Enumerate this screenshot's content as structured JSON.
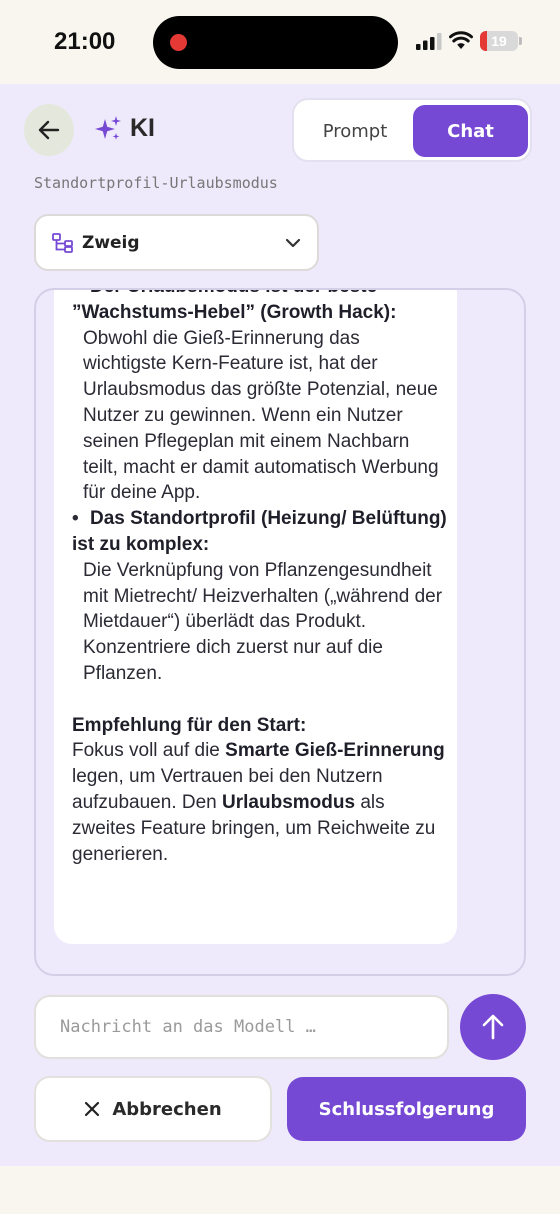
{
  "status_bar": {
    "time": "21:00",
    "battery_level": "19",
    "icons": [
      "cellular-signal-icon",
      "wifi-icon",
      "battery-icon"
    ],
    "recording_indicator_color": "#e53935"
  },
  "header": {
    "back_icon": "arrow-left-icon",
    "title_icon": "sparkles-icon",
    "title": "KI",
    "tabs": [
      {
        "label": "Prompt",
        "active": false
      },
      {
        "label": "Chat",
        "active": true
      }
    ]
  },
  "context_label": "Standortprofil-Urlaubsmodus",
  "model_select": {
    "icon": "branch-icon",
    "selected": "Zweig",
    "chevron_icon": "chevron-down-icon"
  },
  "response": {
    "partial_top_line": "Der Urlaubsmodus ist der beste",
    "sections": [
      {
        "heading": "”Wachstums-Hebel” (Growth Hack):",
        "body": "Obwohl die Gieß-Erinnerung das wichtigste Kern-Feature ist, hat der Urlaubsmodus das größte Potenzial, neue Nutzer zu gewinnen. Wenn ein Nutzer seinen Pflegeplan mit einem Nachbarn teilt, macht er damit automatisch Werbung für deine App."
      },
      {
        "heading": "Das Standortprofil (Heizung/ Belüftung) ist zu komplex:",
        "body": "Die Verknüpfung von Pflanzengesundheit mit Mietrecht/ Heizverhalten („während der Mietdauer“) überlädt das Produkt. Konzentriere dich zuerst nur auf die Pflanzen."
      }
    ],
    "recommendation": {
      "heading": "Empfehlung für den Start:",
      "text_1": "Fokus voll auf die ",
      "bold_1": "Smarte Gieß-Erinnerung",
      "text_2": " legen, um Vertrauen bei den Nutzern aufzubauen. Den ",
      "bold_2": "Urlaubsmodus",
      "text_3": " als zweites Feature bringen, um Reichweite zu generieren."
    }
  },
  "composer": {
    "placeholder": "Nachricht an das Modell …",
    "value": "",
    "send_icon": "arrow-up-icon"
  },
  "actions": {
    "cancel_icon": "close-icon",
    "cancel_label": "Abbrechen",
    "conclude_label": "Schlussfolgerung"
  },
  "colors": {
    "accent": "#7649d4",
    "screen_background": "#eeeafb",
    "system_background": "#f8f6ee"
  }
}
